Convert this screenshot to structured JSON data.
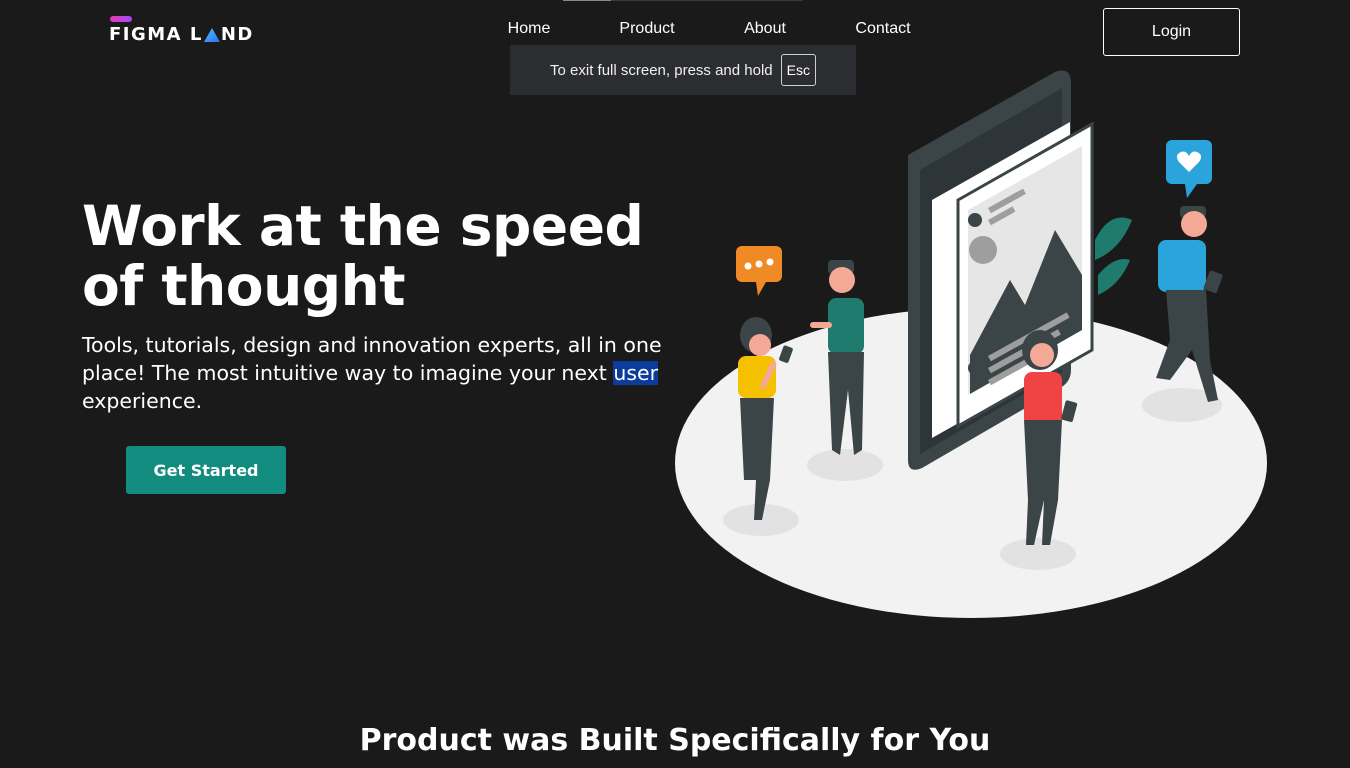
{
  "header": {
    "logo_text_left": "FIGMA L",
    "logo_text_right": "ND",
    "nav": [
      {
        "label": "Home"
      },
      {
        "label": "Product"
      },
      {
        "label": "About"
      },
      {
        "label": "Contact"
      }
    ],
    "login_label": "Login"
  },
  "fullscreen_toast": {
    "message": "To exit full screen, press and hold",
    "key": "Esc"
  },
  "hero": {
    "title": "Work at the speed of thought",
    "subtitle_before": "Tools, tutorials, design and innovation experts, all in one place! The most intuitive way to imagine your next ",
    "subtitle_highlight": "user",
    "subtitle_after": " experience.",
    "cta_label": "Get Started"
  },
  "section": {
    "title": "Product was Built Specifically for You"
  },
  "colors": {
    "background": "#1a1a1a",
    "accent": "#128c7e",
    "highlight": "#0b3b9c",
    "logo_gradient_start": "#e83aa9",
    "logo_triangle": "#3aa6f0"
  },
  "icons": {
    "illustration": "people-using-phones-illustration",
    "logo_triangle": "triangle-icon"
  }
}
